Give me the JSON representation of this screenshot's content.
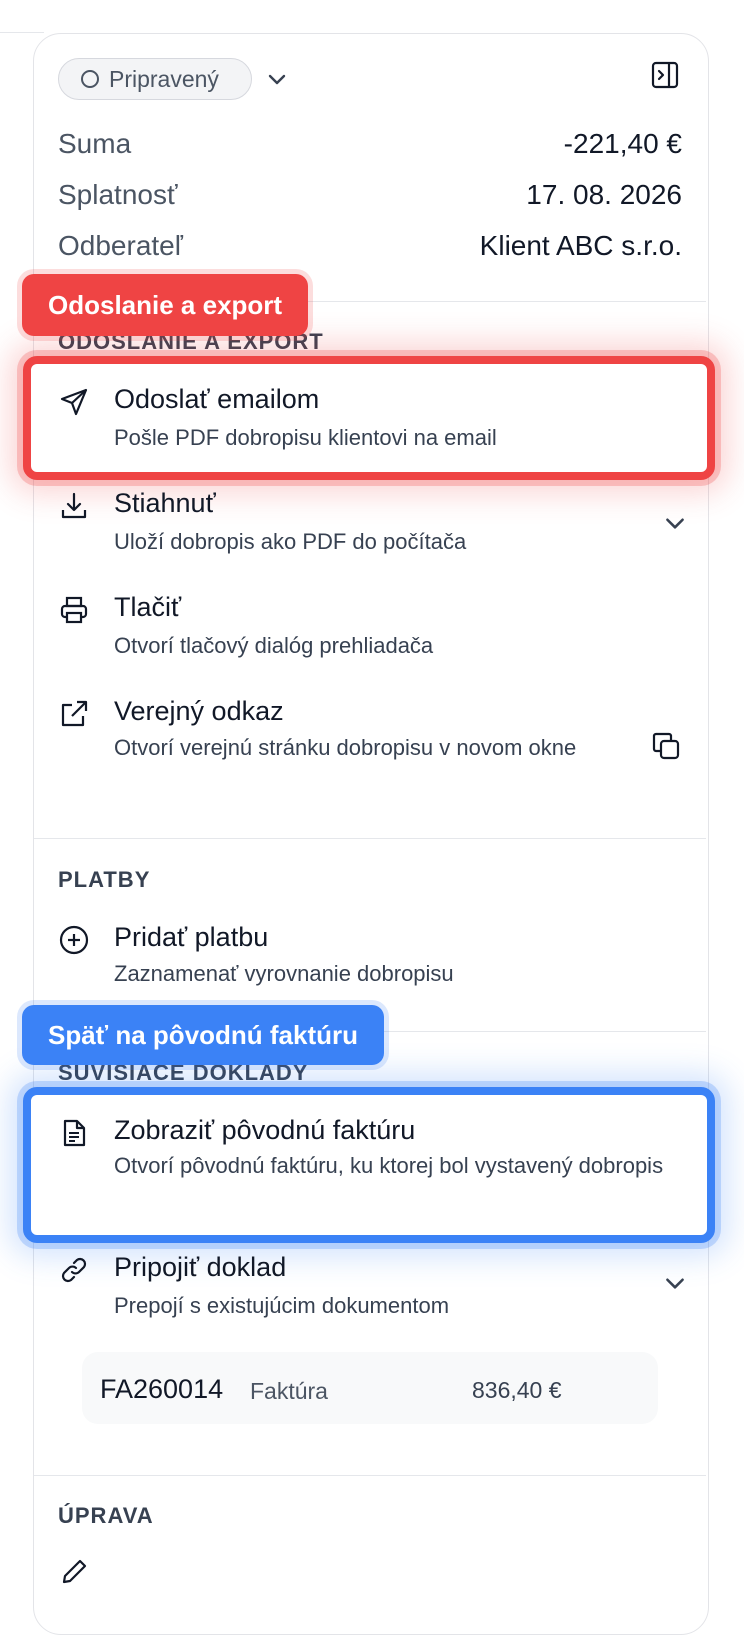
{
  "header": {
    "status": "Pripravený"
  },
  "summary": [
    {
      "label": "Suma",
      "value": "-221,40 €"
    },
    {
      "label": "Splatnosť",
      "value": "17. 08. 2026"
    },
    {
      "label": "Odberateľ",
      "value": "Klient ABC s.r.o."
    }
  ],
  "sections": {
    "send_export": {
      "label": "ODOSLANIE A EXPORT",
      "items": [
        {
          "title": "Odoslať emailom",
          "desc": "Pošle PDF dobropisu klientovi na email",
          "icon": "send-icon"
        },
        {
          "title": "Stiahnuť",
          "desc": "Uloží dobropis ako PDF do počítača",
          "icon": "download-icon"
        },
        {
          "title": "Tlačiť",
          "desc": "Otvorí tlačový dialóg prehliadača",
          "icon": "printer-icon"
        },
        {
          "title": "Verejný odkaz",
          "desc": "Otvorí verejnú stránku dobropisu v novom okne",
          "icon": "external-link-icon"
        }
      ]
    },
    "payments": {
      "label": "PLATBY",
      "items": [
        {
          "title": "Pridať platbu",
          "desc": "Zaznamenať vyrovnanie dobropisu",
          "icon": "plus-circle-icon"
        }
      ]
    },
    "related": {
      "label": "SÚVISIACE DOKLADY",
      "items": [
        {
          "title": "Zobraziť pôvodnú faktúru",
          "desc": "Otvorí pôvodnú faktúru, ku ktorej bol vystavený dobropis",
          "icon": "document-icon"
        },
        {
          "title": "Pripojiť doklad",
          "desc": "Prepojí s existujúcim dokumentom",
          "icon": "link-icon"
        }
      ],
      "linked_doc": {
        "number": "FA260014",
        "type": "Faktúra",
        "amount": "836,40 €"
      }
    },
    "edit": {
      "label": "ÚPRAVA"
    }
  },
  "annotations": {
    "red": {
      "label": "Odoslanie a export",
      "color": "#ef4444"
    },
    "blue": {
      "label": "Späť na pôvodnú faktúru",
      "color": "#3b82f6"
    }
  }
}
